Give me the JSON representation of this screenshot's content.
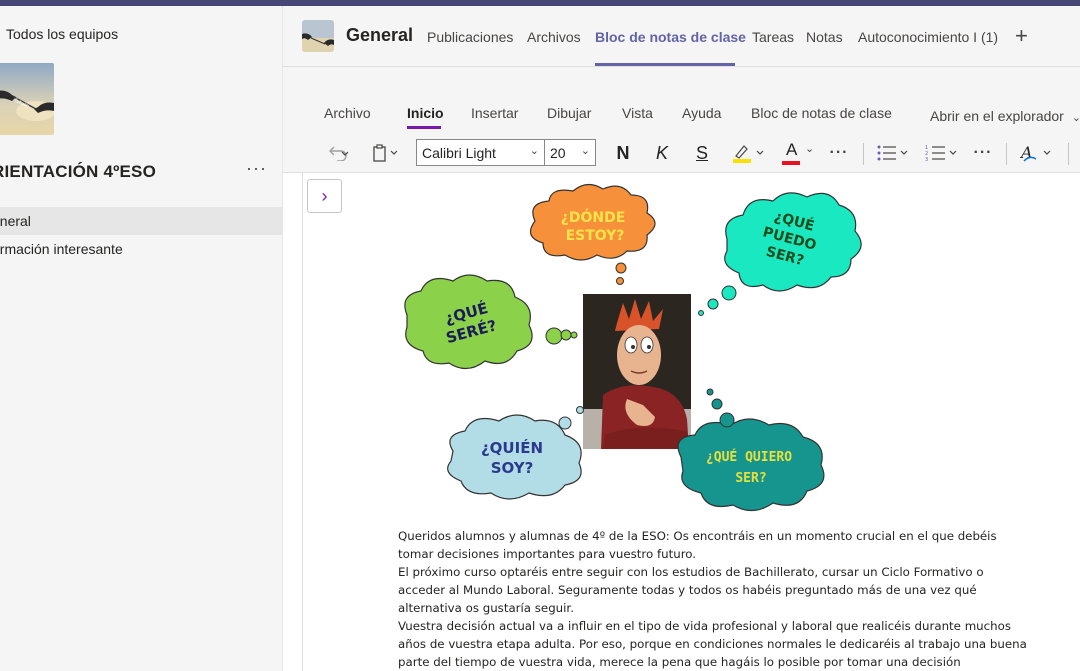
{
  "left_panel": {
    "back_label": "Todos los equipos",
    "team_name": "RIENTACIÓN 4ºESO",
    "more_label": "···",
    "channels": [
      {
        "label": "eneral",
        "active": true
      },
      {
        "label": "ormación interesante",
        "active": false
      }
    ]
  },
  "header": {
    "channel_title": "General",
    "tabs": [
      "Publicaciones",
      "Archivos",
      "Bloc de notas de clase",
      "Tareas",
      "Notas",
      "Autoconocimiento I (1)"
    ],
    "active_tab": "Bloc de notas de clase",
    "add_tab": "+"
  },
  "ribbon": {
    "tabs": [
      "Archivo",
      "Inicio",
      "Insertar",
      "Dibujar",
      "Vista",
      "Ayuda",
      "Bloc de notas de clase"
    ],
    "active_tab": "Inicio",
    "open_in_explorer": "Abrir en el explorador",
    "font_name": "Calibri Light",
    "font_size": "20",
    "bold": "N",
    "italic": "K",
    "strike": "S",
    "font_color_letter": "A",
    "more": "···",
    "highlight_color": "#fce100",
    "font_color": "#e81123"
  },
  "illustration": {
    "cloud_top": [
      "¿DÓNDE",
      "ESTOY?"
    ],
    "cloud_right": [
      "¿QUÉ",
      "PUEDO",
      "SER?"
    ],
    "cloud_left": [
      "¿QUÉ",
      "SERÉ?"
    ],
    "cloud_bottom_left": [
      "¿QUIÉN",
      "SOY?"
    ],
    "cloud_bottom_right": [
      "¿QUÉ QUIERO",
      "SER?"
    ],
    "colors": {
      "orange": "#f7903a",
      "aqua": "#19e8c0",
      "green": "#8cd14a",
      "lightblue": "#b3dde6",
      "teal": "#16958f"
    }
  },
  "body": {
    "paragraphs": [
      "Queridos alumnos y alumnas de 4º de la ESO: Os encontráis en un momento crucial en el que debéis tomar decisiones importantes para vuestro futuro.",
      "El próximo curso optaréis entre seguir con los estudios de Bachillerato, cursar un Ciclo Formativo o acceder al Mundo Laboral. Seguramente todas y todos os habéis preguntado más de una vez qué alternativa os gustaría seguir.",
      "Vuestra decisión actual va a influir en el tipo de vida profesional y laboral que realicéis durante muchos años de vuestra etapa adulta. Por eso, porque en condiciones normales le dedicaréis al trabajo una buena parte del tiempo de vuestra vida, merece la pena que hagáis lo posible por tomar una decisión"
    ]
  }
}
